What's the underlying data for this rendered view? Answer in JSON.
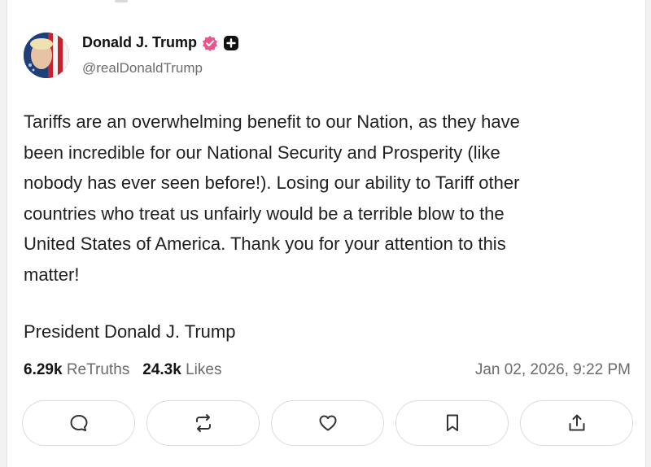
{
  "post": {
    "author_name": "Donald J. Trump",
    "author_handle": "@realDonaldTrump",
    "body_lines": [
      "Tariffs are an overwhelming benefit to our Nation, as they have",
      "been incredible for our National Security and Prosperity (like",
      "nobody has ever seen before!). Losing our ability to Tariff other",
      "countries who treat us unfairly would be a terrible blow to the",
      "United States of America. Thank you for your attention to this",
      "matter!"
    ],
    "signature": "President Donald J. Trump",
    "retruths_count": "6.29k",
    "retruths_label": "ReTruths",
    "likes_count": "24.3k",
    "likes_label": "Likes",
    "timestamp": "Jan 02, 2026, 9:22 PM"
  },
  "actions": [
    {
      "icon": "reply-icon"
    },
    {
      "icon": "retruth-icon"
    },
    {
      "icon": "heart-icon"
    },
    {
      "icon": "bookmark-icon"
    },
    {
      "icon": "share-icon"
    }
  ],
  "colors": {
    "verified_badge": "#e8558a",
    "background": "#ffffff",
    "muted_text": "#6b6b6b"
  }
}
